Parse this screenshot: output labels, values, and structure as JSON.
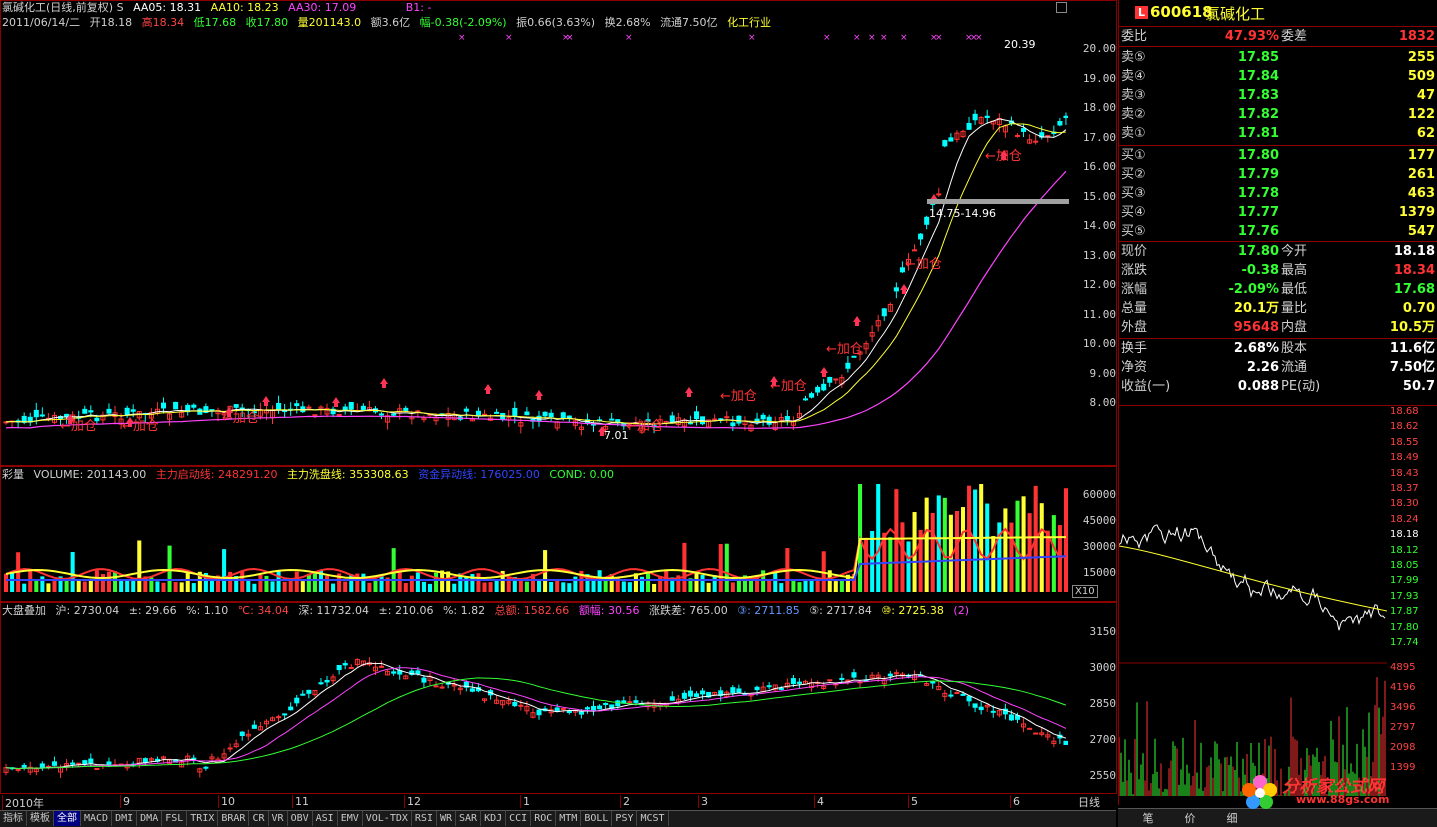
{
  "info": {
    "title": "氯碱化工(日线,前复权) S",
    "ma5": "AA05: 18.31",
    "ma10": "AA10: 18.23",
    "ma30": "AA30: 17.09",
    "b1": "B1: -",
    "bar_date": "2011/06/14/二",
    "bar_open": "开18.18",
    "bar_high": "高18.34",
    "bar_low": "低17.68",
    "bar_close": "收17.80",
    "bar_vol": "量201143.0",
    "bar_amount": "额3.6亿",
    "bar_change": "幅-0.38(-2.09%)",
    "bar_amp": "振0.66(3.63%)",
    "bar_turnover": "换2.68%",
    "bar_float": "流通7.50亿",
    "bar_industry": "化工行业"
  },
  "main_chart": {
    "price_labels": [
      "20.00",
      "19.00",
      "18.00",
      "17.00",
      "16.00",
      "15.00",
      "14.00",
      "13.00",
      "12.00",
      "11.00",
      "10.00",
      "9.00",
      "8.00"
    ],
    "high_mark": "20.39",
    "low_mark": "7.01",
    "band_label": "14.75-14.96",
    "add_label": "加仓"
  },
  "volume_panel": {
    "title": "彩量",
    "volume": "VOLUME: 201143.00",
    "start_line": "主力启动线: 248291.20",
    "wash_line": "主力洗盘线: 353308.63",
    "capital_line": "资金异动线: 176025.00",
    "cond": "COND: 0.00",
    "axis": [
      "60000",
      "45000",
      "30000",
      "15000"
    ],
    "unit": "X10"
  },
  "index_panel": {
    "title": "大盘叠加",
    "sh": "沪: 2730.04",
    "pm1": "±: 29.66",
    "pct1": "%: 1.10",
    "temp": "℃: 34.04",
    "sz": "深: 11732.04",
    "pm2": "±: 210.06",
    "pct2": "%: 1.82",
    "amount": "总额: 1582.66",
    "amp": "额幅: 30.56",
    "updown": "涨跌差: 765.00",
    "m3": "③: 2711.85",
    "m5": "⑤: 2717.84",
    "m10": "⑩: 2725.38",
    "page": "(2)",
    "axis": [
      "3150",
      "3000",
      "2850",
      "2700",
      "2550"
    ]
  },
  "time_axis": [
    "2010年",
    "9",
    "10",
    "11",
    "12",
    "1",
    "2",
    "3",
    "4",
    "5",
    "6"
  ],
  "period": "日线",
  "tabs": [
    "指标",
    "模板",
    "全部",
    "MACD",
    "DMI",
    "DMA",
    "FSL",
    "TRIX",
    "BRAR",
    "CR",
    "VR",
    "OBV",
    "ASI",
    "EMV",
    "VOL-TDX",
    "RSI",
    "WR",
    "SAR",
    "KDJ",
    "CCI",
    "ROC",
    "MTM",
    "BOLL",
    "PSY",
    "MCST"
  ],
  "active_tab": "全部",
  "stock": {
    "badge": "L",
    "code": "600618",
    "name": "氯碱化工"
  },
  "order_book": {
    "wei_bi_label": "委比",
    "wei_bi": "47.93%",
    "wei_cha_label": "委差",
    "wei_cha": "1832",
    "asks": [
      {
        "label": "卖⑤",
        "price": "17.85",
        "qty": "255"
      },
      {
        "label": "卖④",
        "price": "17.84",
        "qty": "509"
      },
      {
        "label": "卖③",
        "price": "17.83",
        "qty": "47"
      },
      {
        "label": "卖②",
        "price": "17.82",
        "qty": "122"
      },
      {
        "label": "卖①",
        "price": "17.81",
        "qty": "62"
      }
    ],
    "bids": [
      {
        "label": "买①",
        "price": "17.80",
        "qty": "177"
      },
      {
        "label": "买②",
        "price": "17.79",
        "qty": "261"
      },
      {
        "label": "买③",
        "price": "17.78",
        "qty": "463"
      },
      {
        "label": "买④",
        "price": "17.77",
        "qty": "1379"
      },
      {
        "label": "买⑤",
        "price": "17.76",
        "qty": "547"
      }
    ]
  },
  "quote": [
    {
      "l1": "现价",
      "v1": "17.80",
      "c1": "green",
      "l2": "今开",
      "v2": "18.18",
      "c2": "white"
    },
    {
      "l1": "涨跌",
      "v1": "-0.38",
      "c1": "green",
      "l2": "最高",
      "v2": "18.34",
      "c2": "red"
    },
    {
      "l1": "涨幅",
      "v1": "-2.09%",
      "c1": "green",
      "l2": "最低",
      "v2": "17.68",
      "c2": "green"
    },
    {
      "l1": "总量",
      "v1": "20.1万",
      "c1": "yellow",
      "l2": "量比",
      "v2": "0.70",
      "c2": "yellow"
    },
    {
      "l1": "外盘",
      "v1": "95648",
      "c1": "red",
      "l2": "内盘",
      "v2": "10.5万",
      "c2": "yellow"
    }
  ],
  "fundamentals": [
    {
      "l1": "换手",
      "v1": "2.68%",
      "l2": "股本",
      "v2": "11.6亿"
    },
    {
      "l1": "净资",
      "v1": "2.26",
      "l2": "流通",
      "v2": "7.50亿"
    },
    {
      "l1": "收益(一)",
      "v1": "0.088",
      "l2": "PE(动)",
      "v2": "50.7"
    }
  ],
  "intraday": {
    "price_axis": [
      "18.68",
      "18.62",
      "18.55",
      "18.49",
      "18.43",
      "18.37",
      "18.30",
      "18.24",
      "18.18",
      "18.12",
      "18.05",
      "17.99",
      "17.93",
      "17.87",
      "17.80",
      "17.74"
    ],
    "vol_axis": [
      "4895",
      "4196",
      "3496",
      "2797",
      "2098",
      "1399"
    ]
  },
  "bottom_tabs": [
    "笔",
    "价",
    "细"
  ],
  "watermark": {
    "name": "分析家公式网",
    "url": "www.88gs.com"
  }
}
